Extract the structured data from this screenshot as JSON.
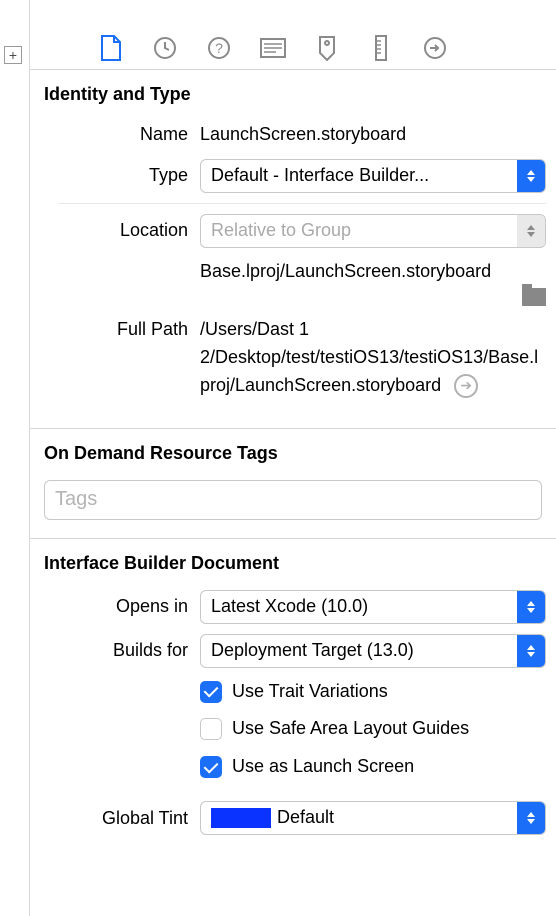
{
  "toolbar": {
    "icons": [
      "file-icon",
      "history-icon",
      "help-icon",
      "identity-icon",
      "tag-icon",
      "ruler-icon",
      "connections-icon"
    ]
  },
  "identity": {
    "title": "Identity and Type",
    "name_label": "Name",
    "name_value": "LaunchScreen.storyboard",
    "type_label": "Type",
    "type_value": "Default - Interface Builder...",
    "location_label": "Location",
    "location_value": "Relative to Group",
    "relative_path": "Base.lproj/LaunchScreen.storyboard",
    "full_path_label": "Full Path",
    "full_path_value": "/Users/Dast 1 2/Desktop/test/testiOS13/testiOS13/Base.lproj/LaunchScreen.storyboard"
  },
  "odr": {
    "title": "On Demand Resource Tags",
    "placeholder": "Tags"
  },
  "ib": {
    "title": "Interface Builder Document",
    "opens_in_label": "Opens in",
    "opens_in_value": "Latest Xcode (10.0)",
    "builds_for_label": "Builds for",
    "builds_for_value": "Deployment Target (13.0)",
    "use_trait": "Use Trait Variations",
    "use_safe_area": "Use Safe Area Layout Guides",
    "use_launch": "Use as Launch Screen",
    "global_tint_label": "Global Tint",
    "global_tint_value": "Default",
    "global_tint_color": "#0a33ff"
  }
}
